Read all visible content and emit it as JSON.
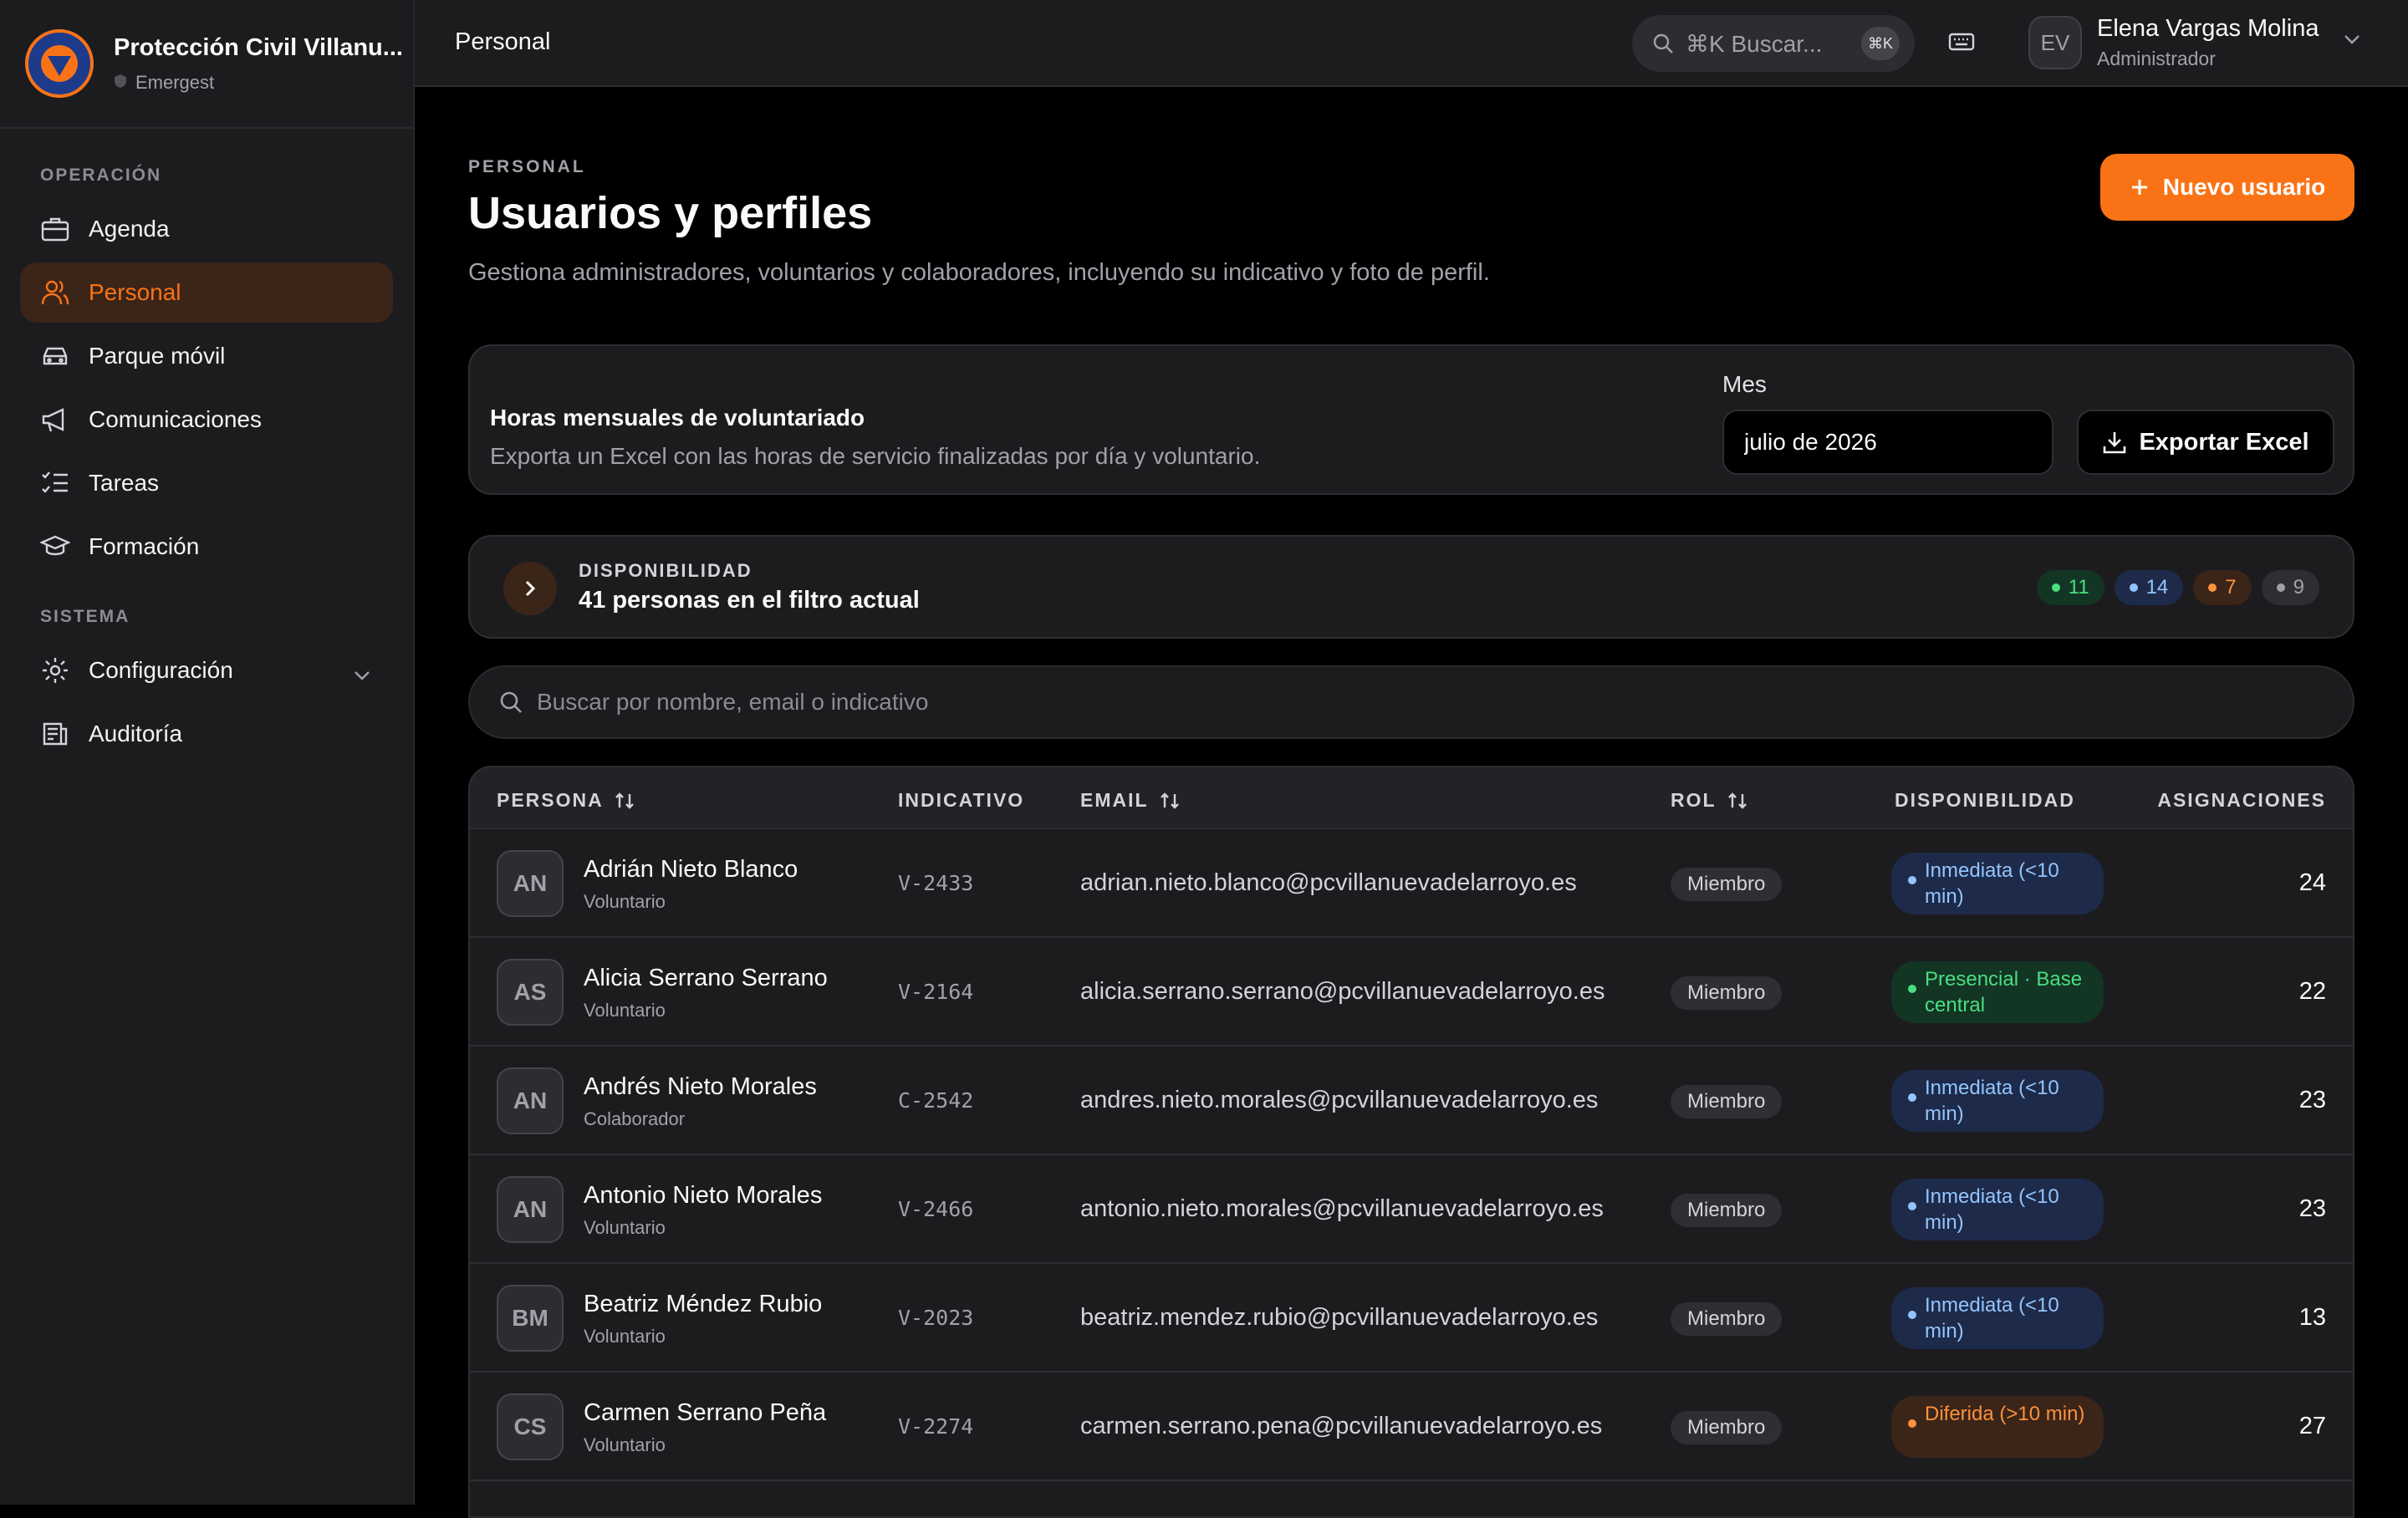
{
  "brand": {
    "title": "Protección Civil Villanu...",
    "subtitle": "Emergest"
  },
  "sidebar": {
    "sections": [
      "OPERACIÓN",
      "SISTEMA"
    ],
    "items": [
      {
        "label": "Agenda",
        "icon": "briefcase-icon"
      },
      {
        "label": "Personal",
        "icon": "users-icon",
        "active": true
      },
      {
        "label": "Parque móvil",
        "icon": "car-icon"
      },
      {
        "label": "Comunicaciones",
        "icon": "megaphone-icon"
      },
      {
        "label": "Tareas",
        "icon": "checklist-icon"
      },
      {
        "label": "Formación",
        "icon": "graduation-cap-icon"
      },
      {
        "label": "Configuración",
        "icon": "gear-icon"
      },
      {
        "label": "Auditoría",
        "icon": "audit-log-icon"
      }
    ]
  },
  "topbar": {
    "title": "Personal",
    "search_label": "⌘K Buscar...",
    "search_kbd": "⌘K",
    "user": {
      "initials": "EV",
      "name": "Elena Vargas Molina",
      "role": "Administrador"
    }
  },
  "page": {
    "eyebrow": "PERSONAL",
    "title": "Usuarios y perfiles",
    "description": "Gestiona administradores, voluntarios y colaboradores, incluyendo su indicativo y foto de perfil.",
    "new_button": "Nuevo usuario"
  },
  "hours": {
    "title": "Horas mensuales de voluntariado",
    "description": "Exporta un Excel con las horas de servicio finalizadas por día y voluntario.",
    "month_label": "Mes",
    "month_value": "julio de 2026",
    "export_button": "Exportar Excel"
  },
  "availability": {
    "eyebrow": "DISPONIBILIDAD",
    "count_text": "41 personas en el filtro actual",
    "pills": [
      {
        "value": "11",
        "color": "#4ade80",
        "bg": "#133524"
      },
      {
        "value": "14",
        "color": "#93c5fd",
        "bg": "#1e2a4a"
      },
      {
        "value": "7",
        "color": "#fb923c",
        "bg": "#3b2418"
      },
      {
        "value": "9",
        "color": "#a1a1aa",
        "bg": "#2e2e33"
      }
    ]
  },
  "search": {
    "placeholder": "Buscar por nombre, email o indicativo"
  },
  "table": {
    "headers": {
      "persona": "PERSONA",
      "indicativo": "INDICATIVO",
      "email": "EMAIL",
      "rol": "ROL",
      "disponibilidad": "DISPONIBILIDAD",
      "asignaciones": "ASIGNACIONES"
    },
    "rows": [
      {
        "initials": "AN",
        "name": "Adrián Nieto Blanco",
        "type": "Voluntario",
        "indicativo": "V-2433",
        "email": "adrian.nieto.blanco@pcvillanuevadelarroyo.es",
        "rol": "Miembro",
        "availability": "Inmediata (<10 min)",
        "availability_kind": "blue",
        "asignaciones": "24"
      },
      {
        "initials": "AS",
        "name": "Alicia Serrano Serrano",
        "type": "Voluntario",
        "indicativo": "V-2164",
        "email": "alicia.serrano.serrano@pcvillanuevadelarroyo.es",
        "rol": "Miembro",
        "availability": "Presencial · Base central",
        "availability_kind": "green",
        "asignaciones": "22"
      },
      {
        "initials": "AN",
        "name": "Andrés Nieto Morales",
        "type": "Colaborador",
        "indicativo": "C-2542",
        "email": "andres.nieto.morales@pcvillanuevadelarroyo.es",
        "rol": "Miembro",
        "availability": "Inmediata (<10 min)",
        "availability_kind": "blue",
        "asignaciones": "23"
      },
      {
        "initials": "AN",
        "name": "Antonio Nieto Morales",
        "type": "Voluntario",
        "indicativo": "V-2466",
        "email": "antonio.nieto.morales@pcvillanuevadelarroyo.es",
        "rol": "Miembro",
        "availability": "Inmediata (<10 min)",
        "availability_kind": "blue",
        "asignaciones": "23"
      },
      {
        "initials": "BM",
        "name": "Beatriz Méndez Rubio",
        "type": "Voluntario",
        "indicativo": "V-2023",
        "email": "beatriz.mendez.rubio@pcvillanuevadelarroyo.es",
        "rol": "Miembro",
        "availability": "Inmediata (<10 min)",
        "availability_kind": "blue",
        "asignaciones": "13"
      },
      {
        "initials": "CS",
        "name": "Carmen Serrano Peña",
        "type": "Voluntario",
        "indicativo": "V-2274",
        "email": "carmen.serrano.pena@pcvillanuevadelarroyo.es",
        "rol": "Miembro",
        "availability": "Diferida (>10 min)",
        "availability_kind": "orange",
        "asignaciones": "27"
      }
    ]
  }
}
